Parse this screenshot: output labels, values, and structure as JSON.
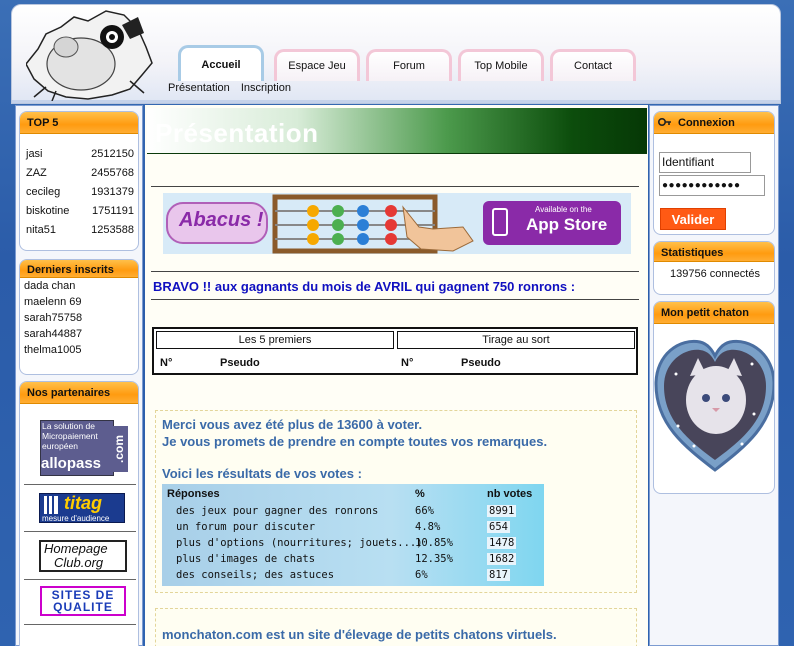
{
  "header": {
    "tabs": [
      {
        "label": "Accueil",
        "active": true
      },
      {
        "label": "Espace Jeu"
      },
      {
        "label": "Forum"
      },
      {
        "label": "Top Mobile"
      },
      {
        "label": "Contact"
      }
    ],
    "subnav": [
      "Présentation",
      "Inscription"
    ]
  },
  "left": {
    "top5": {
      "title": "TOP 5",
      "rows": [
        {
          "name": "jasi",
          "score": "2512150"
        },
        {
          "name": "ZAZ",
          "score": "2455768"
        },
        {
          "name": "cecileg",
          "score": "1931379"
        },
        {
          "name": "biskotine",
          "score": "1751191"
        },
        {
          "name": "nita51",
          "score": "1253588"
        }
      ]
    },
    "inscrits": {
      "title": "Derniers inscrits",
      "items": [
        "dada chan",
        "maelenn 69",
        "sarah75758",
        "sarah44887",
        "thelma1005"
      ]
    },
    "partners": {
      "title": "Nos partenaires",
      "allopass": {
        "l1": "La solution de",
        "l2": "Micropaiement",
        "l3": "européen",
        "brand": "allopass",
        "com": ".com"
      },
      "titag": {
        "brand": "titag",
        "sub": "mesure d'audience"
      },
      "homepage": {
        "l1": "Homepage",
        "l2": "Club.org"
      },
      "sites": {
        "l1": "SITES DE",
        "l2": "QUALITE"
      }
    }
  },
  "center": {
    "title": "Présentation",
    "banner": {
      "brand": "Abacus !",
      "store_small": "Available on the",
      "store_big": "App Store"
    },
    "bravo": "BRAVO !! aux gagnants du mois de AVRIL qui gagnent 750 ronrons :",
    "winners": {
      "col1": "Les 5 premiers",
      "col2": "Tirage au sort",
      "n": "N°",
      "pseudo": "Pseudo"
    },
    "vote": {
      "l1": "Merci vous avez été plus de 13600 à voter.",
      "l2": "Je vous promets de prendre en compte toutes vos remarques.",
      "l3": "Voici les résultats de vos votes :",
      "headers": {
        "resp": "Réponses",
        "pct": "%",
        "nb": "nb votes"
      },
      "rows": [
        {
          "resp": "des jeux pour gagner des ronrons",
          "pct": "66%",
          "nb": "8991"
        },
        {
          "resp": "un forum pour discuter",
          "pct": "4.8%",
          "nb": "654"
        },
        {
          "resp": "plus d'options (nourritures; jouets...)",
          "pct": "10.85%",
          "nb": "1478"
        },
        {
          "resp": "plus d'images de chats",
          "pct": "12.35%",
          "nb": "1682"
        },
        {
          "resp": "des conseils; des astuces",
          "pct": "6%",
          "nb": "817"
        }
      ]
    },
    "footer": "monchaton.com est un site d'élevage de petits chatons virtuels."
  },
  "right": {
    "login": {
      "title": "Connexion",
      "identifiant": "Identifiant",
      "password_mask": "●●●●●●●●●●●●",
      "button": "Valider"
    },
    "stats": {
      "title": "Statistiques",
      "text": "139756 connectés"
    },
    "chaton": {
      "title": "Mon petit chaton"
    }
  },
  "colors": {
    "orange_header": "#ff9b10",
    "blue_text": "#3a6aa8",
    "bravo_blue": "#1010c0",
    "valider": "#ff5a14"
  }
}
